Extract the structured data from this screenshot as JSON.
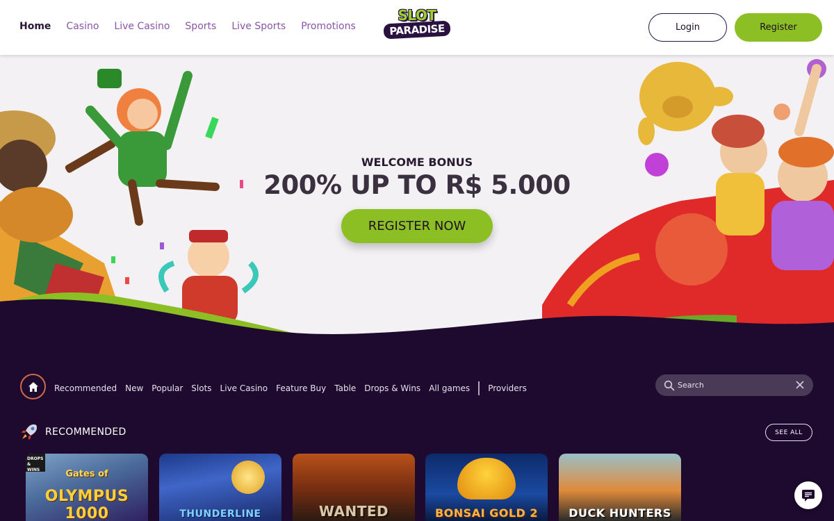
{
  "colors": {
    "brand_green": "#8cbf24",
    "brand_purple_dark": "#1e0a2e",
    "nav_link": "#8a55a8",
    "nav_active": "#2a1638"
  },
  "header": {
    "nav": [
      {
        "label": "Home",
        "active": true
      },
      {
        "label": "Casino",
        "active": false
      },
      {
        "label": "Live Casino",
        "active": false
      },
      {
        "label": "Sports",
        "active": false
      },
      {
        "label": "Live Sports",
        "active": false
      },
      {
        "label": "Promotions",
        "active": false
      }
    ],
    "logo": {
      "line1": "SLOT",
      "line2": "PARADISE"
    },
    "login_label": "Login",
    "register_label": "Register"
  },
  "hero": {
    "welcome_label": "WELCOME BONUS",
    "bonus_title": "200% UP TO R$ 5.000",
    "cta_label": "REGISTER NOW"
  },
  "categories": {
    "home_icon": "home-icon",
    "items": [
      "Recommended",
      "New",
      "Popular",
      "Slots",
      "Live Casino",
      "Feature Buy",
      "Table",
      "Drops & Wins",
      "All games"
    ],
    "providers_label": "Providers"
  },
  "search": {
    "placeholder": "Search",
    "value": ""
  },
  "recommended": {
    "icon": "rocket-icon",
    "title": "RECOMMENDED",
    "see_all_label": "SEE ALL",
    "games": [
      {
        "title_top": "Gates of",
        "title": "OLYMPUS 1000",
        "badge": "DROPS & WINS"
      },
      {
        "title": "THUNDERLINE"
      },
      {
        "title": "WANTED"
      },
      {
        "title": "BONSAI GOLD 2"
      },
      {
        "title": "DUCK HUNTERS"
      }
    ]
  },
  "chat": {
    "icon": "chat-icon"
  }
}
